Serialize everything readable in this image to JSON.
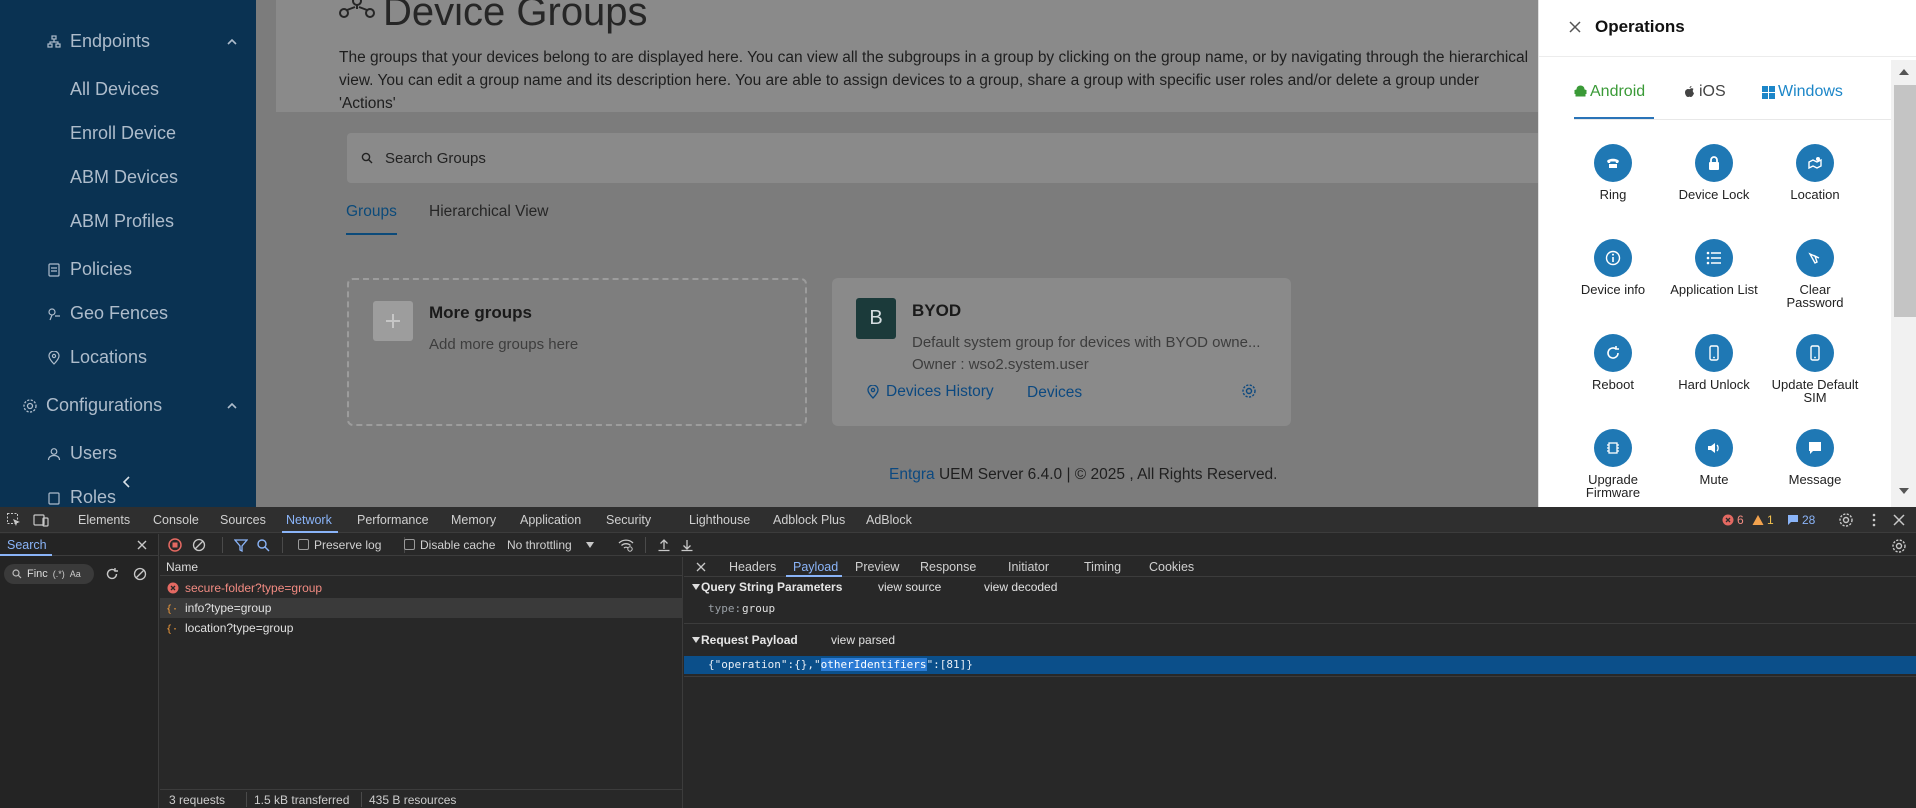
{
  "sidebar": {
    "endpoints": "Endpoints",
    "sub_items": [
      "All Devices",
      "Enroll Device",
      "ABM Devices",
      "ABM Profiles"
    ],
    "policies": "Policies",
    "geo_fences": "Geo Fences",
    "locations": "Locations",
    "configurations": "Configurations",
    "users": "Users",
    "roles": "Roles"
  },
  "main": {
    "title": "Device Groups",
    "description": "The groups that your devices belong to are displayed here. You can view all the subgroups in a group by clicking on the group name, or by navigating through the hierarchical view. You can edit a group name and its description here. You are able to assign devices to a group, share a group with specific user roles and/or delete a group under 'Actions'",
    "search_placeholder": "Search Groups",
    "tabs": [
      "Groups",
      "Hierarchical View"
    ],
    "more_groups": {
      "title": "More groups",
      "subtitle": "Add more groups here"
    },
    "group_card": {
      "initial": "B",
      "name": "BYOD",
      "description": "Default system group for devices with BYOD owne...",
      "owner": "Owner : wso2.system.user",
      "history_link": "Devices History",
      "devices_link": "Devices"
    },
    "footer": {
      "brand": "Entgra",
      "rest": " UEM Server 6.4.0 | © 2025 , All Rights Reserved."
    }
  },
  "drawer": {
    "title": "Operations",
    "os_tabs": [
      "Android",
      "iOS",
      "Windows"
    ],
    "operations": [
      {
        "label": "Ring",
        "icon": "phone-icon"
      },
      {
        "label": "Device Lock",
        "icon": "lock-icon"
      },
      {
        "label": "Location",
        "icon": "map-icon"
      },
      {
        "label": "Device info",
        "icon": "info-icon"
      },
      {
        "label": "Application List",
        "icon": "list-icon"
      },
      {
        "label": "Clear Password",
        "icon": "eraser-icon"
      },
      {
        "label": "Reboot",
        "icon": "reboot-icon"
      },
      {
        "label": "Hard Unlock",
        "icon": "mobile-icon"
      },
      {
        "label": "Update Default SIM",
        "icon": "mobile-icon"
      },
      {
        "label": "Upgrade Firmware",
        "icon": "chip-icon"
      },
      {
        "label": "Mute",
        "icon": "speaker-icon"
      },
      {
        "label": "Message",
        "icon": "message-icon"
      }
    ]
  },
  "devtools": {
    "tabs": [
      "Elements",
      "Console",
      "Sources",
      "Network",
      "Performance",
      "Memory",
      "Application",
      "Security",
      "Lighthouse",
      "Adblock Plus",
      "AdBlock"
    ],
    "active_tab": "Network",
    "errors": "6",
    "warnings": "1",
    "messages": "28",
    "search_label": "Search",
    "find_placeholder": "Finc",
    "find_regex": "(.*)",
    "find_case": "Aa",
    "preserve_log": "Preserve log",
    "disable_cache": "Disable cache",
    "throttling": "No throttling",
    "name_col": "Name",
    "requests": [
      {
        "name": "secure-folder?type=group",
        "state": "error"
      },
      {
        "name": "info?type=group",
        "state": "selected"
      },
      {
        "name": "location?type=group",
        "state": "normal"
      }
    ],
    "footer": [
      "3 requests",
      "1.5 kB transferred",
      "435 B resources"
    ],
    "detail_tabs": [
      "Headers",
      "Payload",
      "Preview",
      "Response",
      "Initiator",
      "Timing",
      "Cookies"
    ],
    "active_detail_tab": "Payload",
    "query_string": {
      "title": "Query String Parameters",
      "view_source": "view source",
      "view_decoded": "view decoded",
      "param_key": "type:",
      "param_value": "group"
    },
    "request_payload": {
      "title": "Request Payload",
      "view_parsed": "view parsed",
      "code_before": "{\"operation\":{},\"",
      "code_highlight": "otherIdentifiers",
      "code_after": "\":[81]}"
    }
  }
}
